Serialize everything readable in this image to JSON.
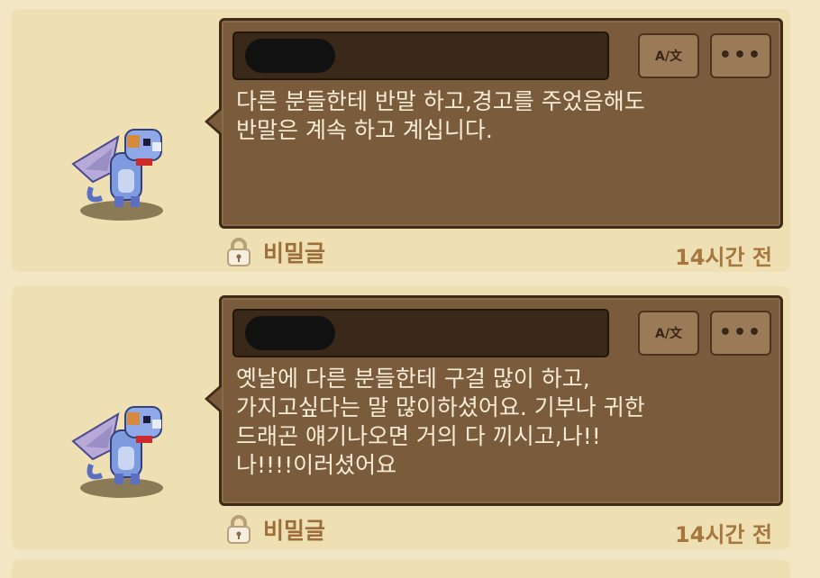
{
  "posts": [
    {
      "message": "다른 분들한테 반말 하고,경고를 주었음해도\n반말은 계속 하고 계십니다.",
      "secret_label": "비밀글",
      "time": "14시간 전",
      "translate_label": "A/文",
      "more_label": "•••"
    },
    {
      "message": "옛날에 다른 분들한테 구걸 많이 하고,\n가지고싶다는 말 많이하셨어요. 기부나 귀한\n드래곤 얘기나오면 거의 다 끼시고,나!!\n나!!!!이러셨어요",
      "secret_label": "비밀글",
      "time": "14시간 전",
      "translate_label": "A/文",
      "more_label": "•••"
    }
  ],
  "colors": {
    "background": "#f2e6c4",
    "card": "#efe0b3",
    "bubble": "#7a5c3d",
    "name_bar": "#3a2918",
    "accent_text": "#a6763f"
  }
}
